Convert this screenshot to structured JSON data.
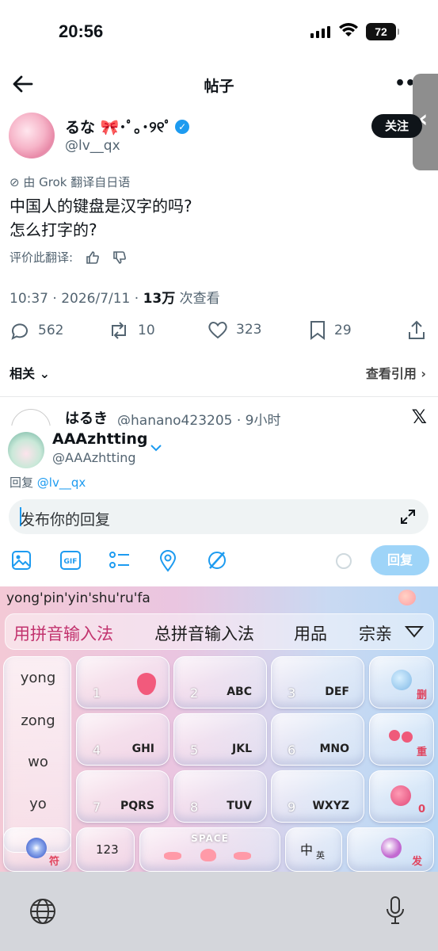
{
  "status_bar": {
    "time": "20:56",
    "battery": "72"
  },
  "nav": {
    "title": "帖子"
  },
  "post": {
    "author_name": "るな 🎀･ﾟ｡･୨୧ﾟ",
    "author_handle": "@lv__qx",
    "follow_label": "关注",
    "translated_label": "由 Grok 翻译自日语",
    "text_line1": "中国人的键盘是汉字的吗?",
    "text_line2": "怎么打字的?",
    "rate_label": "评价此翻译:",
    "time_date": "10:37 · 2026/7/11 · ",
    "views_count": "13万",
    "views_label": " 次查看"
  },
  "actions": {
    "replies": "562",
    "reposts": "10",
    "likes": "323",
    "bookmarks": "29"
  },
  "related": {
    "left": "相关",
    "right": "查看引用"
  },
  "reply_preview": {
    "name": "はるき",
    "handle": "@hanano423205 · 9小时"
  },
  "compose": {
    "name": "AAAzhtting",
    "handle": "@AAAzhtting",
    "reply_to_prefix": "回复 ",
    "reply_to_handle": "@lv__qx",
    "placeholder": "发布你的回复",
    "reply_button": "回复"
  },
  "ime": {
    "pinyin": "yong'pin'yin'shu'ru'fa",
    "candidates": [
      "用拼音输入法",
      "总拼音输入法",
      "用品",
      "宗亲"
    ],
    "side_items": [
      "yong",
      "zong",
      "wo",
      "yo"
    ],
    "keys": [
      {
        "num": "1",
        "letters": ""
      },
      {
        "num": "2",
        "letters": "ABC"
      },
      {
        "num": "3",
        "letters": "DEF"
      },
      {
        "num": "4",
        "letters": "GHI"
      },
      {
        "num": "5",
        "letters": "JKL"
      },
      {
        "num": "6",
        "letters": "MNO"
      },
      {
        "num": "7",
        "letters": "PQRS"
      },
      {
        "num": "8",
        "letters": "TUV"
      },
      {
        "num": "9",
        "letters": "WXYZ"
      }
    ],
    "delete_label": "删",
    "redo_label": "重",
    "zero_label": "0",
    "symbol_label": "符",
    "num_label": "123",
    "space_label": "SPACE",
    "lang_zh": "中",
    "lang_en": "英",
    "send_label": "发"
  },
  "colors": {
    "accent": "#1d9bf0",
    "text": "#0f1419",
    "muted": "#536471"
  }
}
